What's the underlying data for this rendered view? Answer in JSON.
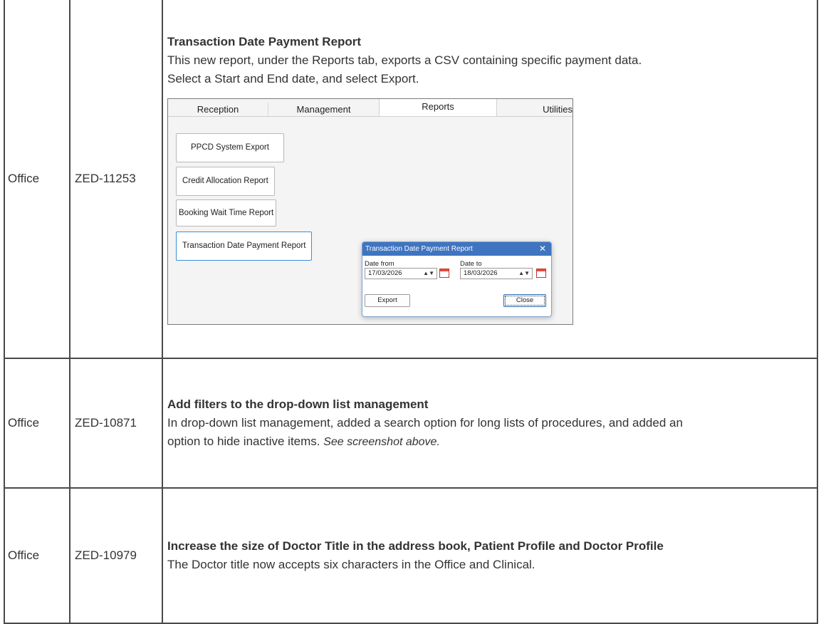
{
  "rows": [
    {
      "area": "Office",
      "ticket": "ZED-11253",
      "title": "Transaction Date Payment Report",
      "lines": [
        "This new report, under the Reports tab, exports a CSV containing specific payment data.",
        "Select a Start and End date, and select Export."
      ],
      "screenshot": {
        "tabs": [
          "Reception",
          "Management",
          "Reports",
          "Utilities"
        ],
        "active_tab": "Reports",
        "report_buttons": [
          "PPCD System Export",
          "Credit Allocation Report",
          "Booking Wait Time Report",
          "Transaction Date Payment Report"
        ],
        "dialog": {
          "title": "Transaction Date Payment Report",
          "close_glyph": "✕",
          "date_from_label": "Date from",
          "date_from_value": "17/03/2026",
          "date_to_label": "Date to",
          "date_to_value": "18/03/2026",
          "export_label": "Export",
          "close_label": "Close"
        }
      }
    },
    {
      "area": "Office",
      "ticket": "ZED-10871",
      "title": "Add filters to the drop-down list management",
      "line1": "In drop-down list management, added a search option for long lists of procedures, and added an",
      "line2_text": "option to hide inactive items. ",
      "line2_em": "See screenshot above."
    },
    {
      "area": "Office",
      "ticket": "ZED-10979",
      "title": "Increase the size of Doctor Title in the address book, Patient Profile and Doctor Profile",
      "lines": [
        "The Doctor title now accepts six characters in the Office and Clinical."
      ]
    }
  ],
  "colors": {
    "border": "#4a4a4a",
    "text": "#333333",
    "dialog_title_bar": "#3f74c1",
    "selected_button_border": "#3a8fd9"
  },
  "icons": [
    "calendar-icon",
    "spinner-icon",
    "close-icon"
  ]
}
